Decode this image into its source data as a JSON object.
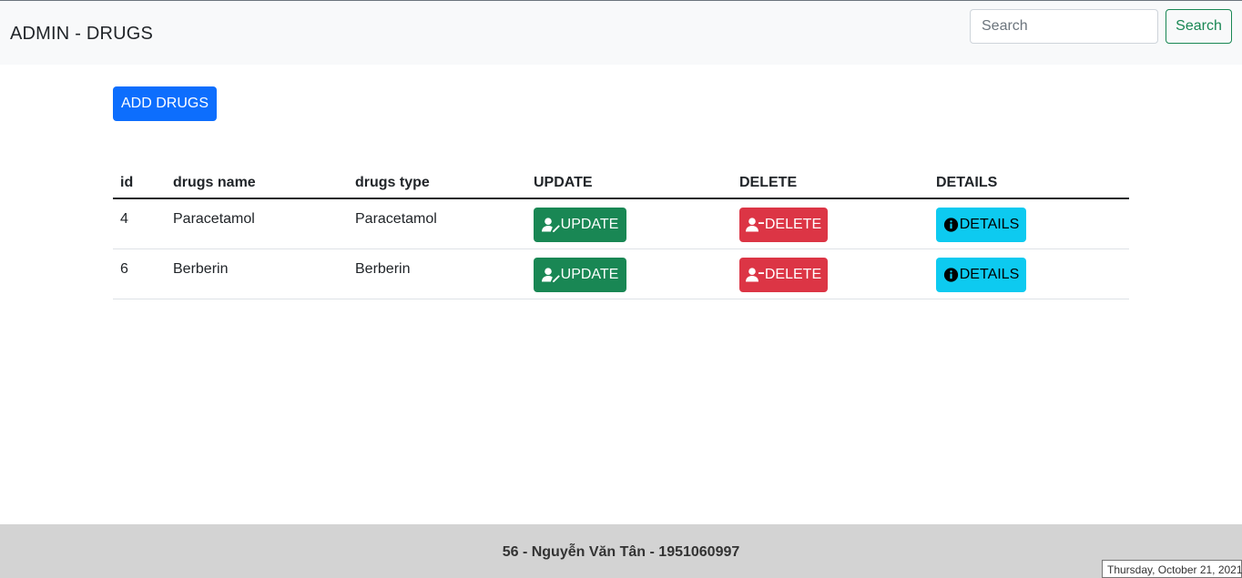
{
  "header": {
    "title": "ADMIN - DRUGS",
    "search_placeholder": "Search",
    "search_button": "Search"
  },
  "toolbar": {
    "add_label": "ADD DRUGS"
  },
  "table": {
    "columns": [
      "id",
      "drugs name",
      "drugs type",
      "UPDATE",
      "DELETE",
      "DETAILS"
    ],
    "rows": [
      {
        "id": "4",
        "name": "Paracetamol",
        "type": "Paracetamol",
        "update": "UPDATE",
        "delete": "DELETE",
        "details": "DETAILS"
      },
      {
        "id": "6",
        "name": "Berberin",
        "type": "Berberin",
        "update": "UPDATE",
        "delete": "DELETE",
        "details": "DETAILS"
      }
    ]
  },
  "footer": {
    "text": "56 - Nguyễn Văn Tân - 1951060997"
  },
  "date_widget": {
    "text": "Thursday, October 21, 2021"
  },
  "colors": {
    "primary": "#0d6efd",
    "success": "#198754",
    "danger": "#dc3545",
    "info": "#0dcaf0"
  },
  "icons": {
    "update": "user-pen-icon",
    "delete": "user-minus-icon",
    "details": "info-circle-icon"
  }
}
